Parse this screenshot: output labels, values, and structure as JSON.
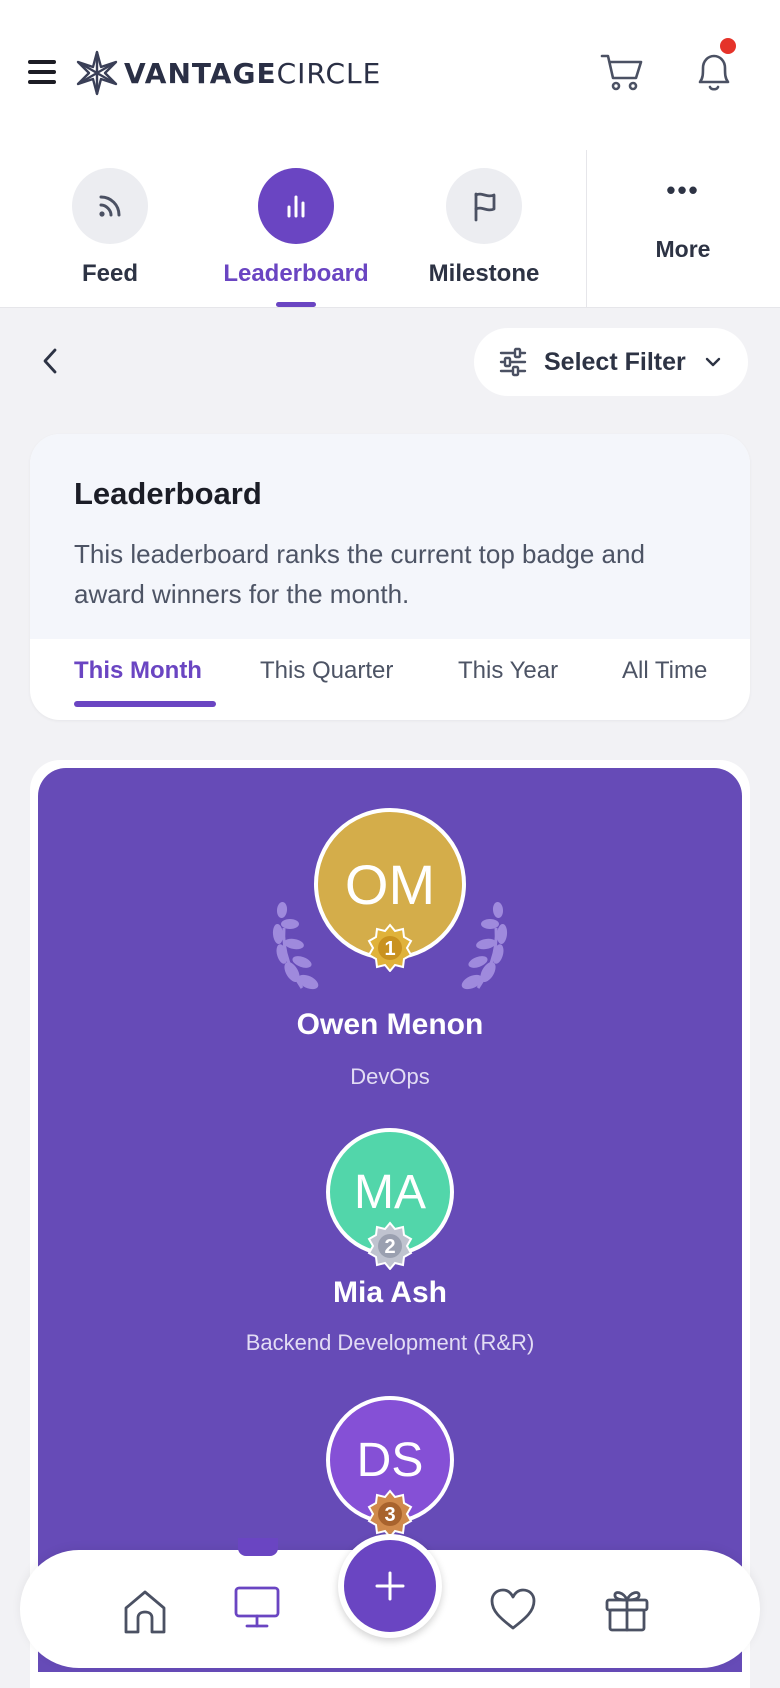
{
  "header": {
    "logo_bold": "VANTAGE",
    "logo_light": "CIRCLE",
    "has_notification": true
  },
  "top_nav": {
    "items": [
      {
        "label": "Feed",
        "icon": "rss-icon"
      },
      {
        "label": "Leaderboard",
        "icon": "bar-chart-icon",
        "active": true
      },
      {
        "label": "Milestone",
        "icon": "flag-icon"
      }
    ],
    "more_label": "More"
  },
  "filter": {
    "label": "Select Filter"
  },
  "leaderboard": {
    "title": "Leaderboard",
    "description": "This leaderboard ranks the current top badge and award winners for the month.",
    "tabs": [
      "This Month",
      "This Quarter",
      "This Year",
      "All Time"
    ],
    "active_tab": "This Month"
  },
  "winners": [
    {
      "rank": "1",
      "initials": "OM",
      "name": "Owen Menon",
      "team": "DevOps",
      "color": "#d4ad4a"
    },
    {
      "rank": "2",
      "initials": "MA",
      "name": "Mia Ash",
      "team": "Backend Development (R&R)",
      "color": "#52d6aa"
    },
    {
      "rank": "3",
      "initials": "DS",
      "name": "",
      "team": "",
      "color": "#8550d6"
    }
  ],
  "bottom_nav": {
    "items": [
      "home-icon",
      "monitor-icon",
      "add-icon",
      "heart-icon",
      "gift-icon"
    ],
    "active": "monitor-icon",
    "fab_symbol": "+"
  },
  "colors": {
    "accent": "#6a45c2",
    "podium_bg": "#664bb7",
    "notification": "#e5332a"
  }
}
